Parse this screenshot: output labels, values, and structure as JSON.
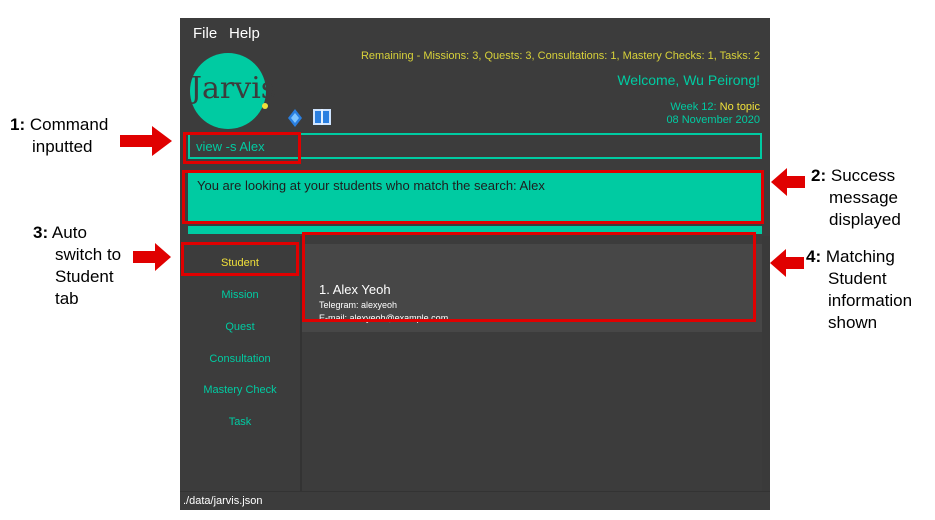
{
  "menu": {
    "file": "File",
    "help": "Help"
  },
  "header": {
    "remaining": "Remaining - Missions: 3, Quests: 3, Consultations: 1, Mastery Checks: 1, Tasks: 2",
    "welcome": "Welcome, Wu Peirong!",
    "week": "Week 12: ",
    "topic": "No topic",
    "date": "08 November 2020",
    "logo_text": "Jarvis"
  },
  "icons": {
    "gem": "gem-icon",
    "book": "book-icon"
  },
  "command": {
    "value": "view -s Alex"
  },
  "result": {
    "text": "You are looking at your students who match the search: Alex"
  },
  "tabs": [
    {
      "label": "Student"
    },
    {
      "label": "Mission"
    },
    {
      "label": "Quest"
    },
    {
      "label": "Consultation"
    },
    {
      "label": "Mastery Check"
    },
    {
      "label": "Task"
    }
  ],
  "students": [
    {
      "title": "1.  Alex Yeoh",
      "telegram": "Telegram: alexyeoh",
      "email": "E-mail: alexyeoh@example.com"
    }
  ],
  "status": {
    "path": "./data/jarvis.json"
  },
  "annotations": {
    "a1": {
      "num": "1:",
      "l1": "Command",
      "l2": "inputted"
    },
    "a2": {
      "num": "2:",
      "l1": "Success",
      "l2": "message",
      "l3": "displayed"
    },
    "a3": {
      "num": "3:",
      "l1": "Auto",
      "l2": "switch to",
      "l3": "Student",
      "l4": "tab"
    },
    "a4": {
      "num": "4:",
      "l1": "Matching",
      "l2": "Student",
      "l3": "information",
      "l4": "shown"
    }
  },
  "colors": {
    "accent": "#00cba2",
    "yellow": "#f0e03a",
    "background": "#3c3c3c",
    "highlight": "#e00000"
  }
}
